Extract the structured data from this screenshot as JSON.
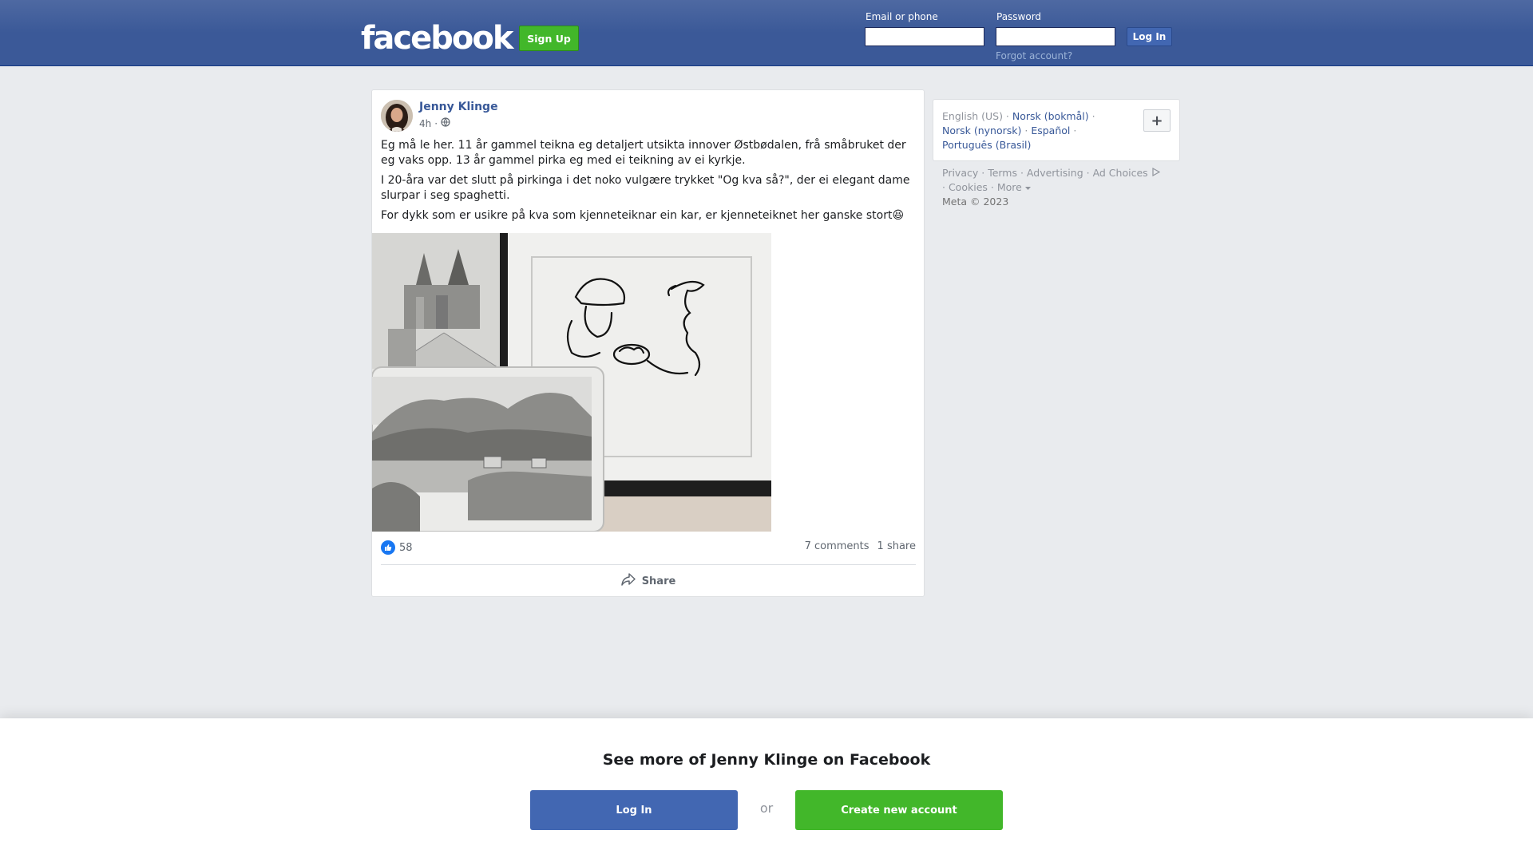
{
  "header": {
    "logo": "facebook",
    "signup_label": "Sign Up",
    "email_label": "Email or phone",
    "email_value": "",
    "password_label": "Password",
    "password_value": "",
    "login_label": "Log In",
    "forgot_label": "Forgot account?"
  },
  "post": {
    "author": "Jenny Klinge",
    "time": "4h",
    "privacy_icon": "globe-icon",
    "paragraphs": [
      "Eg må le her. 11 år gammel teikna eg detaljert utsikta innover Østbødalen, frå småbruket der eg vaks opp. 13 år gammel pirka eg med ei teikning av ei kyrkje.",
      "I 20-åra var det slutt på pirkinga i det noko vulgære trykket \"Og kva så?\", der ei elegant dame slurpar i seg spaghetti.",
      "For dykk som er usikre på kva som kjenneteiknar ein kar, er kjenneteiknet her ganske stort😆"
    ],
    "like_count": "58",
    "comments": "7 comments",
    "shares": "1 share",
    "share_label": "Share"
  },
  "sidebar": {
    "languages": [
      {
        "label": "English (US)",
        "current": true
      },
      {
        "label": "Norsk (bokmål)",
        "current": false
      },
      {
        "label": "Norsk (nynorsk)",
        "current": false
      },
      {
        "label": "Español",
        "current": false
      },
      {
        "label": "Português (Brasil)",
        "current": false
      }
    ],
    "more_languages_label": "+",
    "footer_links": [
      "Privacy",
      "Terms",
      "Advertising",
      "Ad Choices",
      "Cookies",
      "More"
    ],
    "copyright": "Meta © 2023"
  },
  "banner": {
    "title": "See more of Jenny Klinge on Facebook",
    "login_label": "Log In",
    "or_label": "or",
    "create_label": "Create new account"
  },
  "colors": {
    "brand_blue": "#3b5998",
    "button_blue": "#4267b2",
    "green": "#42b72a",
    "link": "#385898"
  }
}
